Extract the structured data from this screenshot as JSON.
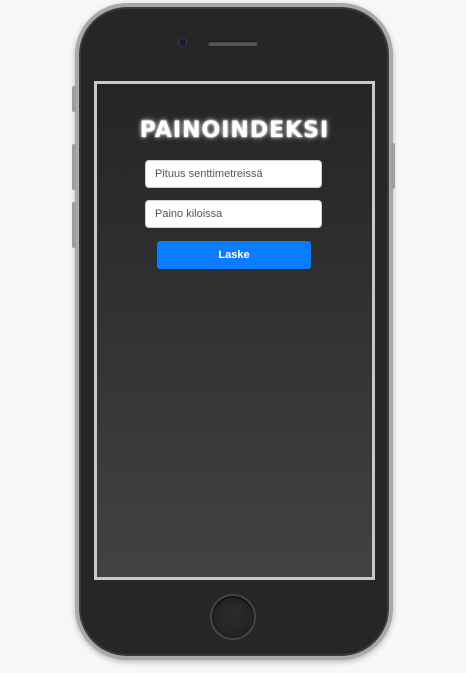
{
  "app": {
    "title": "PAINOINDEKSI"
  },
  "form": {
    "height_placeholder": "Pituus senttimetreissä",
    "height_value": "",
    "weight_placeholder": "Paino kiloissa",
    "weight_value": "",
    "submit_label": "Laske"
  },
  "colors": {
    "accent": "#0a7cff",
    "phone_body": "#262626",
    "phone_frame": "#a9a9a9"
  },
  "icons": {
    "camera": "camera-icon",
    "speaker": "speaker-icon",
    "home": "home-button"
  }
}
